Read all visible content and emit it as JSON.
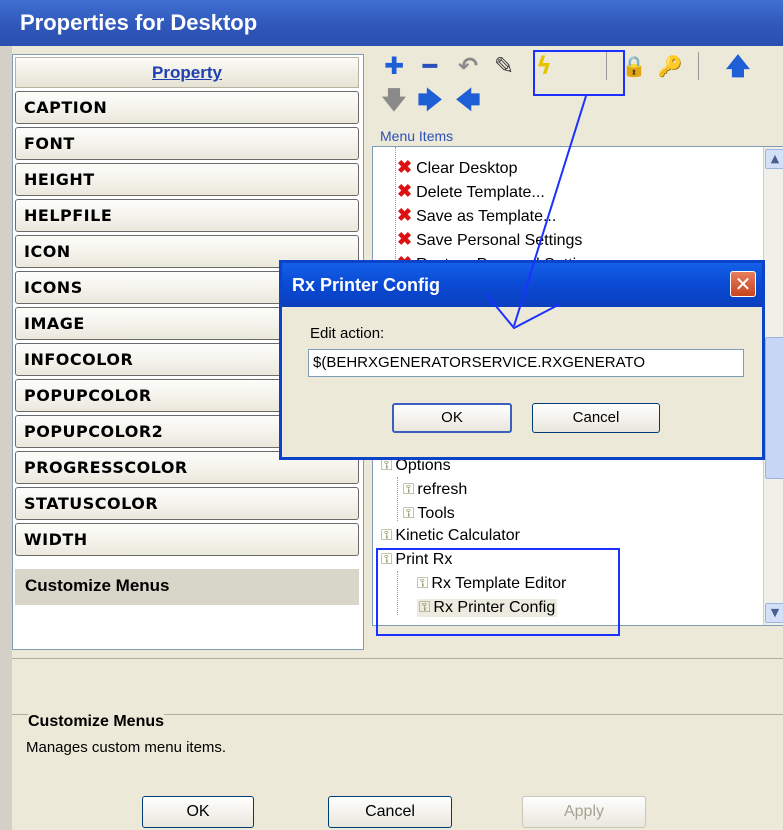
{
  "window": {
    "title": "Properties for Desktop"
  },
  "property_list": {
    "header": "Property",
    "items": [
      "CAPTION",
      "FONT",
      "HEIGHT",
      "HELPFILE",
      "ICON",
      "ICONS",
      "IMAGE",
      "INFOCOLOR",
      "POPUPCOLOR",
      "POPUPCOLOR2",
      "PROGRESSCOLOR",
      "STATUSCOLOR",
      "WIDTH"
    ],
    "selected": "Customize Menus"
  },
  "toolbar": {
    "icons": [
      "plus-icon",
      "minus-icon",
      "undo-icon",
      "pen-icon",
      "lightning-icon",
      "lock-icon",
      "key-icon",
      "arrow-up-icon",
      "arrow-down-icon",
      "arrow-right-icon",
      "arrow-left-icon"
    ],
    "glyphs": {
      "plus": "✚",
      "minus": "━",
      "undo": "↶",
      "pen": "✎",
      "lightning": "ϟ",
      "lock": "🔒",
      "key": "🔑",
      "up": "🡅",
      "down": "🡇",
      "right": "🡆",
      "left": "🡄"
    }
  },
  "menu_items": {
    "label": "Menu Items",
    "nodes": [
      {
        "text": "Clear Desktop",
        "icon": "delete-x-icon"
      },
      {
        "text": "Delete Template...",
        "icon": "delete-x-icon"
      },
      {
        "text": "Save as Template...",
        "icon": "delete-x-icon"
      },
      {
        "text": "Save Personal Settings",
        "icon": "delete-x-icon"
      },
      {
        "text": "Restore Personal Settings",
        "icon": "delete-x-icon"
      },
      {
        "text": "Options",
        "icon": "lock-icon"
      },
      {
        "text": "refresh",
        "icon": "lock-icon"
      },
      {
        "text": "Tools",
        "icon": "lock-icon"
      },
      {
        "text": "Kinetic Calculator",
        "icon": "lock-icon"
      },
      {
        "text": "Print Rx",
        "icon": "lock-icon"
      },
      {
        "text": "Rx Template Editor",
        "icon": "lock-icon"
      },
      {
        "text": "Rx Printer Config",
        "icon": "lock-icon",
        "selected": true
      }
    ]
  },
  "description": {
    "heading": "Customize Menus",
    "text": "Manages custom menu items."
  },
  "buttons": {
    "ok": "OK",
    "cancel": "Cancel",
    "apply": "Apply"
  },
  "dialog": {
    "title": "Rx Printer Config",
    "edit_label": "Edit action:",
    "edit_value": "$(BEHRXGENERATORSERVICE.RXGENERATO",
    "ok": "OK",
    "cancel": "Cancel"
  },
  "colors": {
    "annotation": "#1a32ff",
    "title_bar": "#2e56b8",
    "dialog_caption": "#0a4ad4"
  }
}
